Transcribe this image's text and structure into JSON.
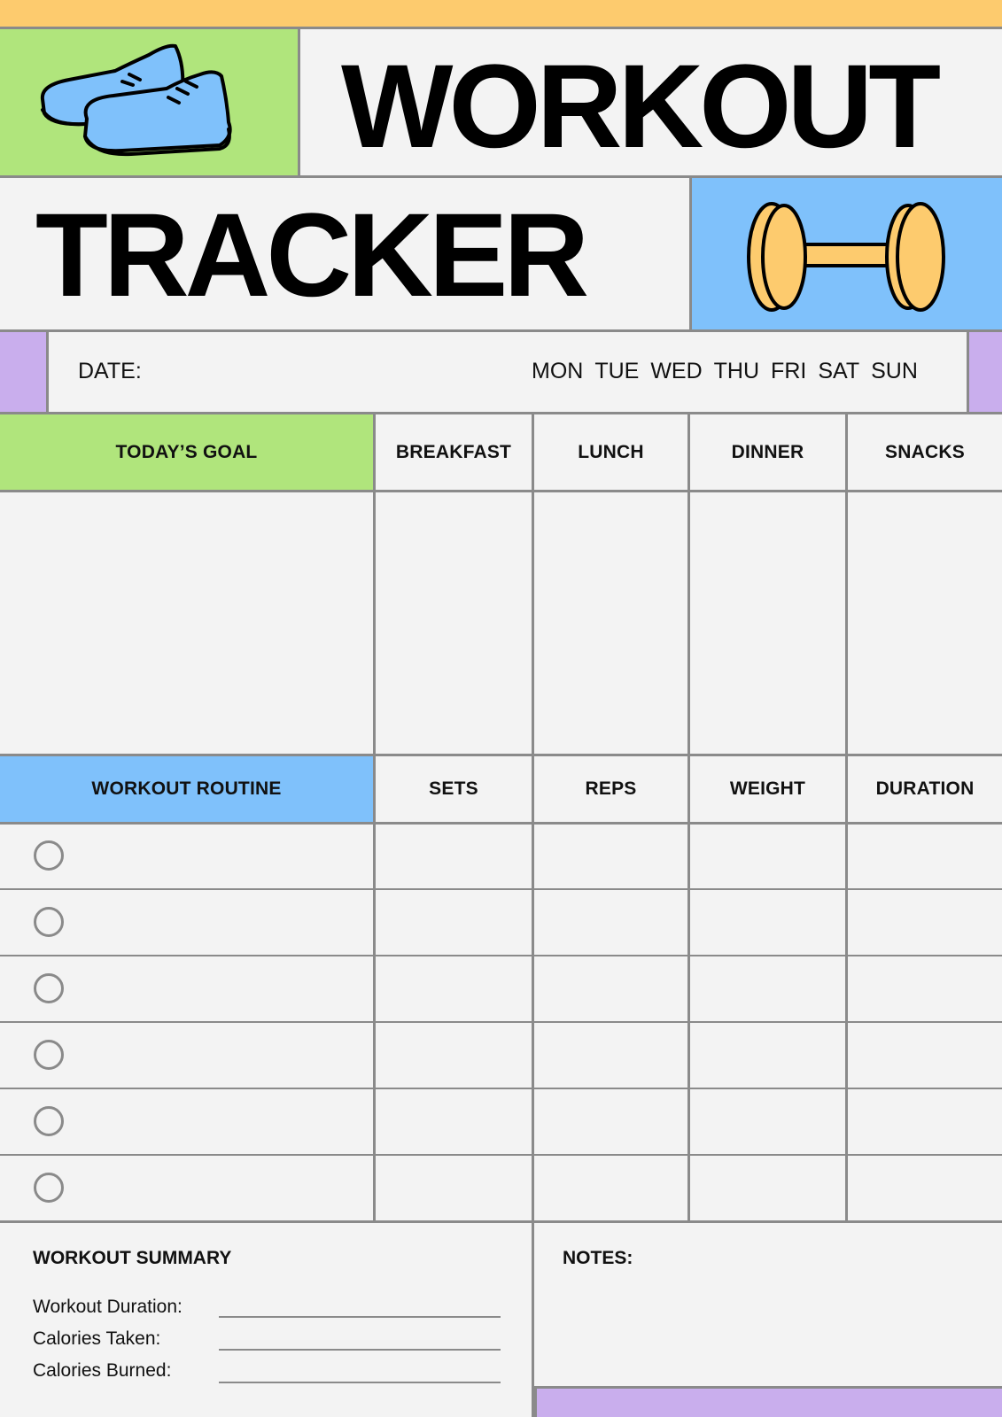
{
  "title": {
    "line1": "WORKOUT",
    "line2": "TRACKER"
  },
  "date_row": {
    "label": "DATE:",
    "days": [
      "MON",
      "TUE",
      "WED",
      "THU",
      "FRI",
      "SAT",
      "SUN"
    ]
  },
  "meals_header": {
    "goal": "TODAY’S GOAL",
    "breakfast": "BREAKFAST",
    "lunch": "LUNCH",
    "dinner": "DINNER",
    "snacks": "SNACKS"
  },
  "routine_header": {
    "routine": "WORKOUT ROUTINE",
    "sets": "SETS",
    "reps": "REPS",
    "weight": "WEIGHT",
    "duration": "DURATION"
  },
  "summary": {
    "title": "WORKOUT SUMMARY",
    "fields": [
      "Workout Duration:",
      "Calories Taken:",
      "Calories Burned:"
    ]
  },
  "notes": {
    "label": "NOTES:"
  },
  "icons": [
    "sneakers-icon",
    "dumbbell-icon",
    "checkbox-circle-icon"
  ],
  "colors": {
    "yellow": "#fdcb6e",
    "green": "#b0e57c",
    "blue": "#7fc1fb",
    "purple": "#c9aeed",
    "background": "#f3f3f3",
    "line": "#8a8a8a"
  }
}
